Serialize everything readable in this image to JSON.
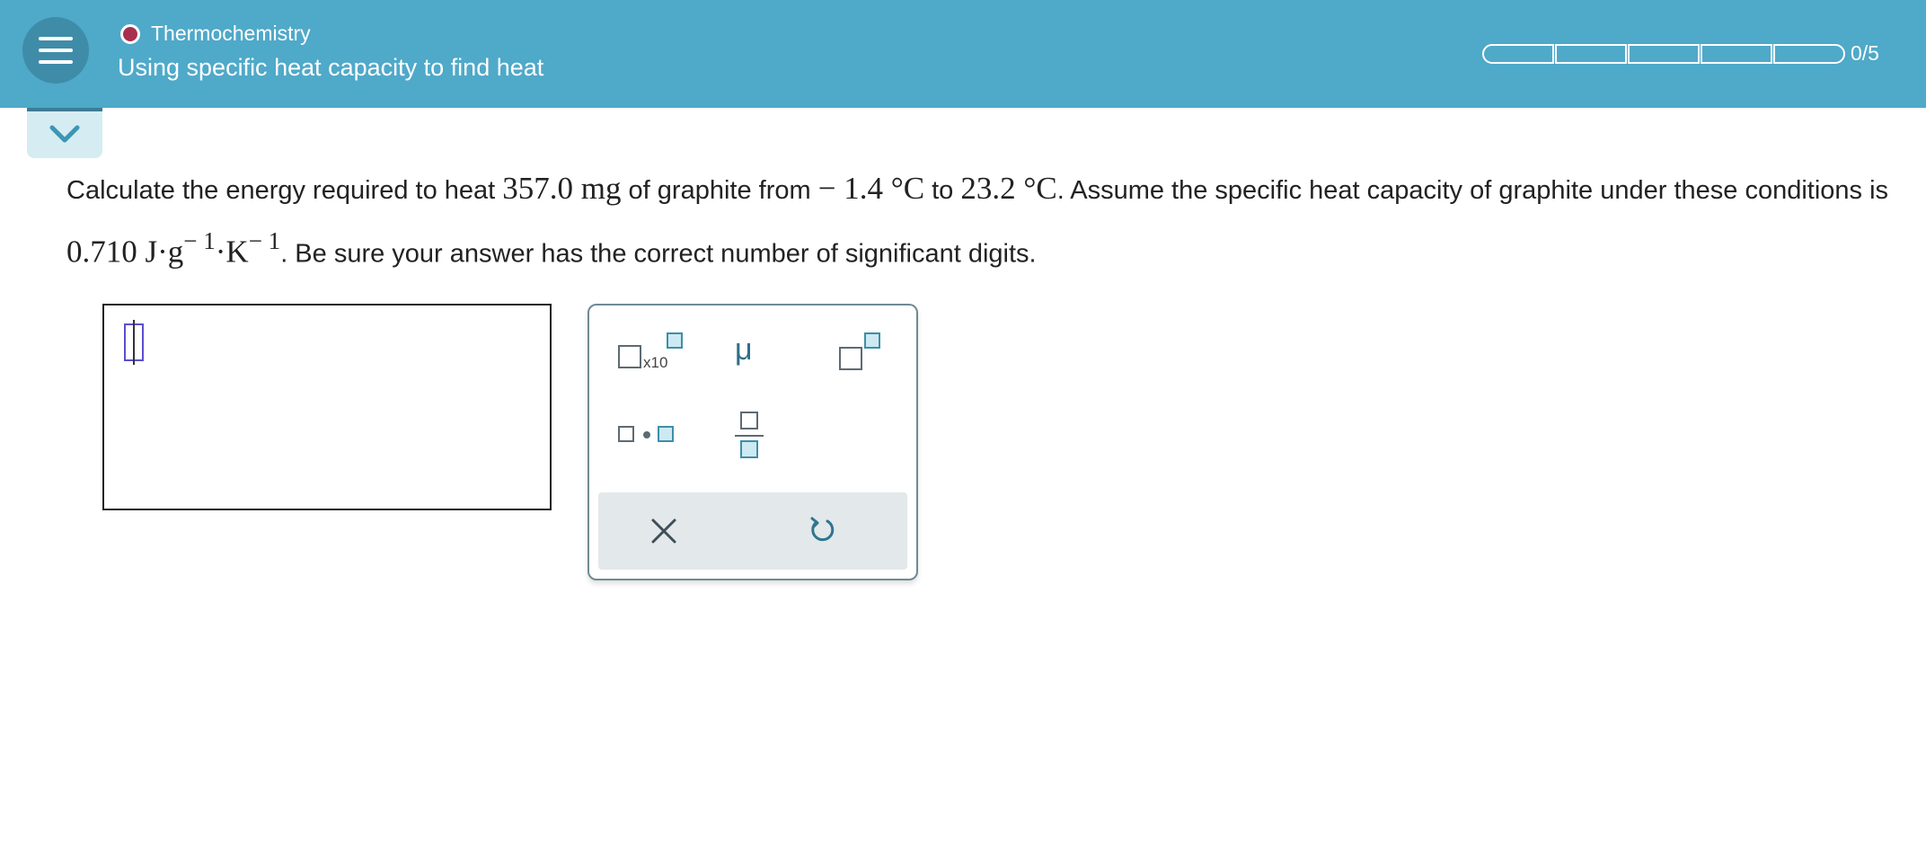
{
  "header": {
    "topic": "Thermochemistry",
    "title": "Using specific heat capacity to find heat",
    "progress": {
      "completed": 0,
      "total": 5,
      "label": "0/5"
    },
    "colors": {
      "bar": "#4fa9c9",
      "topic_dot": "#a8304f"
    }
  },
  "icons": {
    "menu": "hamburger-menu-icon",
    "collapse": "chevron-down-icon",
    "clear": "close-icon",
    "undo": "undo-icon"
  },
  "question": {
    "p1": "Calculate the energy required to heat ",
    "mass": "357.0 mg",
    "p2": " of graphite from ",
    "t1": "− 1.4 °C",
    "p3": " to ",
    "t2": "23.2 °C",
    "p4": ". Assume the specific heat capacity of graphite under these conditions is ",
    "c_value": "0.710 J·g",
    "exp1": "− 1",
    "c_unit": "·K",
    "exp2": "− 1",
    "p5": ". Be sure your answer has the correct number of significant digits."
  },
  "answer": {
    "value": ""
  },
  "palette": {
    "x10_label": "x10",
    "mu_label": "μ"
  }
}
